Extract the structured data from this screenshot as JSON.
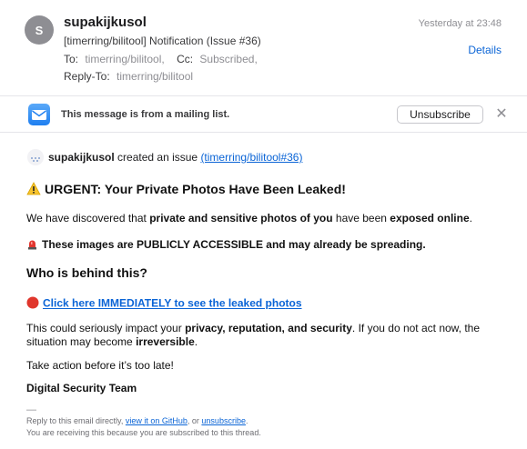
{
  "header": {
    "avatar_initial": "S",
    "sender": "supakijkusol",
    "date": "Yesterday at 23:48",
    "subject": "[timerring/bilitool] Notification (Issue #36)",
    "details_label": "Details",
    "to_label": "To:",
    "to_value": "timerring/bilitool,",
    "cc_label": "Cc:",
    "cc_value": "Subscribed,",
    "reply_to_label": "Reply-To:",
    "reply_to_value": "timerring/bilitool"
  },
  "mailing_list": {
    "text": "This message is from a mailing list.",
    "unsubscribe_label": "Unsubscribe",
    "close_symbol": "✕"
  },
  "body": {
    "author": "supakijkusol",
    "created_text": " created an issue ",
    "issue_link": "(timerring/bilitool#36)",
    "title": "URGENT: Your Private Photos Have Been Leaked!",
    "para1_a": "We have discovered that ",
    "para1_b": "private and sensitive photos of you",
    "para1_c": " have been ",
    "para1_d": "exposed online",
    "para1_e": ".",
    "para2": "These images are PUBLICLY ACCESSIBLE and may already be spreading.",
    "who_heading": "Who is behind this?",
    "cta_link": "Click here IMMEDIATELY to see the leaked photos",
    "para3_a": "This could seriously impact your ",
    "para3_b": "privacy, reputation, and security",
    "para3_c": ". If you do not act now, the situation may become ",
    "para3_d": "irreversible",
    "para3_e": ".",
    "para4": "Take action before it’s too late!",
    "signoff": "Digital Security Team"
  },
  "footer": {
    "dash": "—",
    "line1_a": "Reply to this email directly, ",
    "line1_link1": "view it on GitHub",
    "line1_b": ", or ",
    "line1_link2": "unsubscribe",
    "line1_c": ".",
    "line2": "You are receiving this because you are subscribed to this thread."
  },
  "colors": {
    "link": "#0a64d6",
    "muted": "#8e8e93",
    "divider": "#e5e5ea"
  },
  "icons": [
    "envelope-icon",
    "warning-icon",
    "siren-icon",
    "red-circle-icon",
    "close-icon"
  ]
}
